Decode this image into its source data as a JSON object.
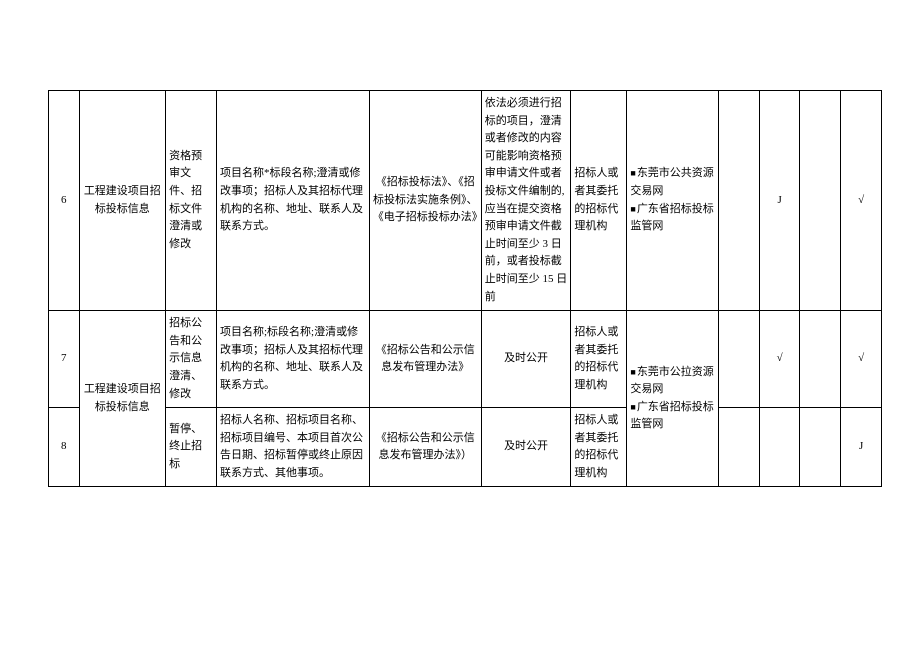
{
  "rows": [
    {
      "idx": "6",
      "category": "工程建设项目招标投标信息",
      "sub": "资格预审文件、招标文件澄清或修改",
      "content": "项目名称*标段名称;澄清或修改事项；招标人及其招标代理机构的名称、地址、联系人及联系方式。",
      "basis": "《招标投标法》、《招标投标法实施条例》、《电子招标投标办法》",
      "time": "依法必须进行招标的项目，澄清或者修改的内容可能影响资格预审申请文件或者投标文件编制的,应当在提交资格预审申请文件截止时间至少 3 日前，或者投标截止时间至少 15 日前",
      "subject": "招标人或者其委托的招标代理机构",
      "c1": "",
      "c2": "J",
      "c3": "",
      "c4": "√"
    },
    {
      "idx": "7",
      "sub": "招标公告和公示信息澄清、修改",
      "content": "项目名称;标段名称;澄清或修改事项；招标人及其招标代理机构的名称、地址、联系人及联系方式。",
      "basis": "《招标公告和公示信息发布管理办法》",
      "time": "及时公开",
      "subject": "招标人或者其委托的招标代理机构",
      "c1": "",
      "c2": "√",
      "c3": "",
      "c4": "√"
    },
    {
      "idx": "8",
      "sub": "暂停、终止招标",
      "content": "招标人名称、招标项目名称、招标项目编号、本项目首次公告日期、招标暂停或终止原因联系方式、其他事项。",
      "basis": "《招标公告和公示信息发布管理办法》）",
      "time": "及时公开",
      "subject": "招标人或者其委托的招标代理机构",
      "c1": "",
      "c2": "",
      "c3": "",
      "c4": "J"
    }
  ],
  "category78": "工程建设项目招标投标信息",
  "channels": {
    "group1": {
      "a": "东莞市公共资源交易网",
      "b": "广东省招标投标监管网"
    },
    "group2": {
      "a": "东莞市公拉资源交易网",
      "b": "广东省招标投标监管网"
    }
  }
}
